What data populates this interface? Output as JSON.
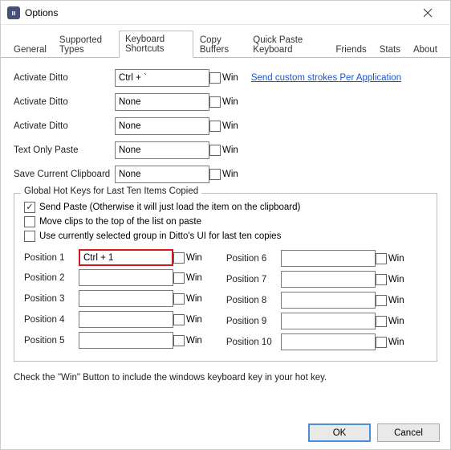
{
  "window": {
    "title": "Options",
    "app_icon_text": "ıı"
  },
  "tabs": {
    "general": "General",
    "supported_types": "Supported Types",
    "keyboard_shortcuts": "Keyboard Shortcuts",
    "copy_buffers": "Copy Buffers",
    "quick_paste_keyboard": "Quick Paste Keyboard",
    "friends": "Friends",
    "stats": "Stats",
    "about": "About",
    "active": "keyboard_shortcuts"
  },
  "shortcuts": [
    {
      "label": "Activate Ditto",
      "value": "Ctrl + `",
      "win": false
    },
    {
      "label": "Activate Ditto",
      "value": "None",
      "win": false
    },
    {
      "label": "Activate Ditto",
      "value": "None",
      "win": false
    },
    {
      "label": "Text Only Paste",
      "value": "None",
      "win": false
    },
    {
      "label": "Save Current Clipboard",
      "value": "None",
      "win": false
    }
  ],
  "win_label": "Win",
  "link_text": "Send custom strokes Per Application",
  "group": {
    "legend": "Global Hot Keys for Last Ten Items Copied",
    "opts": [
      {
        "label": "Send Paste (Otherwise it will just load the item on the clipboard)",
        "checked": true
      },
      {
        "label": "Move clips to the top of the list on paste",
        "checked": false
      },
      {
        "label": "Use currently selected group in Ditto's UI for last ten copies",
        "checked": false
      }
    ],
    "positions_left": [
      {
        "label": "Position 1",
        "value": "Ctrl + 1",
        "win": false,
        "highlight": true
      },
      {
        "label": "Position 2",
        "value": "",
        "win": false
      },
      {
        "label": "Position 3",
        "value": "",
        "win": false
      },
      {
        "label": "Position 4",
        "value": "",
        "win": false
      },
      {
        "label": "Position 5",
        "value": "",
        "win": false
      }
    ],
    "positions_right": [
      {
        "label": "Position 6",
        "value": "",
        "win": false
      },
      {
        "label": "Position 7",
        "value": "",
        "win": false
      },
      {
        "label": "Position 8",
        "value": "",
        "win": false
      },
      {
        "label": "Position 9",
        "value": "",
        "win": false
      },
      {
        "label": "Position 10",
        "value": "",
        "win": false
      }
    ]
  },
  "hint": "Check the \"Win\" Button to include the windows keyboard key in your hot key.",
  "buttons": {
    "ok": "OK",
    "cancel": "Cancel"
  }
}
